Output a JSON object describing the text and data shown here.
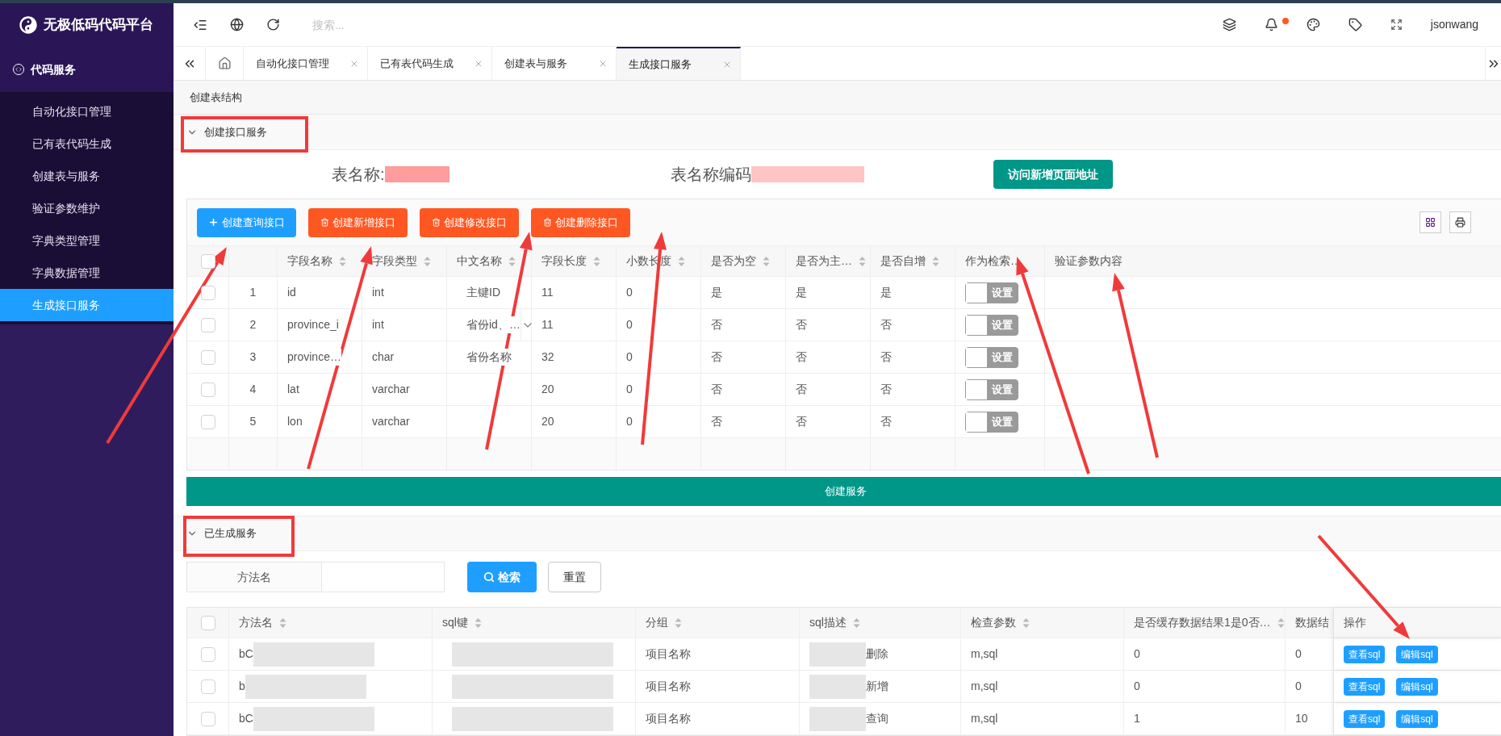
{
  "app": {
    "logo_text": "无极低码代码平台"
  },
  "header": {
    "search_placeholder": "搜索...",
    "notification_dot": true,
    "username": "jsonwang"
  },
  "sidebar": {
    "group": {
      "label": "代码服务",
      "expanded": true
    },
    "items": [
      {
        "label": "自动化接口管理",
        "selected": false
      },
      {
        "label": "已有表代码生成",
        "selected": false
      },
      {
        "label": "创建表与服务",
        "selected": false
      },
      {
        "label": "验证参数维护",
        "selected": false
      },
      {
        "label": "字典类型管理",
        "selected": false
      },
      {
        "label": "字典数据管理",
        "selected": false
      },
      {
        "label": "生成接口服务",
        "selected": true
      }
    ]
  },
  "tabs": [
    {
      "label": "自动化接口管理",
      "selected": false
    },
    {
      "label": "已有表代码生成",
      "selected": false
    },
    {
      "label": "创建表与服务",
      "selected": false
    },
    {
      "label": "生成接口服务",
      "selected": true
    }
  ],
  "breadcrumb": "创建表结构",
  "create_section": {
    "title": "创建接口服务",
    "expanded": true,
    "table_name": {
      "label": "表名称:",
      "redacted": true
    },
    "table_code": {
      "label": "表名称编码",
      "redacted": true
    },
    "visit_button": "访问新增页面地址",
    "all_checked": false,
    "buttons": [
      {
        "kind": "primary",
        "label": "创建查询接口"
      },
      {
        "kind": "danger",
        "label": "创建新增接口"
      },
      {
        "kind": "danger",
        "label": "创建修改接口"
      },
      {
        "kind": "danger",
        "label": "创建删除接口"
      }
    ],
    "columns": [
      {
        "label": "字段名称",
        "sortable": true
      },
      {
        "label": "字段类型",
        "sortable": true
      },
      {
        "label": "中文名称",
        "sortable": true
      },
      {
        "label": "字段长度",
        "sortable": true
      },
      {
        "label": "小数长度",
        "sortable": true
      },
      {
        "label": "是否为空",
        "sortable": true
      },
      {
        "label": "是否为主…",
        "sortable": true
      },
      {
        "label": "是否自增",
        "sortable": true
      },
      {
        "label": "作为检索…",
        "sortable": false
      },
      {
        "label": "验证参数内容",
        "sortable": false
      }
    ],
    "rows": [
      {
        "checked": false,
        "index": "1",
        "field": "id",
        "type": "int",
        "cn_name": {
          "text": "主键ID",
          "dropdown": false
        },
        "length": "11",
        "decimals": "0",
        "nullable": "是",
        "primary": "是",
        "auto_inc": "是",
        "search_switch": {
          "label": "设置",
          "on": false
        }
      },
      {
        "checked": false,
        "index": "2",
        "field": "province_i",
        "type": "int",
        "cn_name": {
          "text": "省份id、…",
          "dropdown": true
        },
        "length": "11",
        "decimals": "0",
        "nullable": "否",
        "primary": "否",
        "auto_inc": "否",
        "search_switch": {
          "label": "设置",
          "on": false
        }
      },
      {
        "checked": false,
        "index": "3",
        "field": "province…",
        "type": "char",
        "cn_name": {
          "text": "省份名称",
          "dropdown": false
        },
        "length": "32",
        "decimals": "0",
        "nullable": "否",
        "primary": "否",
        "auto_inc": "否",
        "search_switch": {
          "label": "设置",
          "on": false
        }
      },
      {
        "checked": false,
        "index": "4",
        "field": "lat",
        "type": "varchar",
        "length": "20",
        "decimals": "0",
        "nullable": "否",
        "primary": "否",
        "auto_inc": "否",
        "search_switch": {
          "label": "设置",
          "on": false
        }
      },
      {
        "checked": false,
        "index": "5",
        "field": "lon",
        "type": "varchar",
        "length": "20",
        "decimals": "0",
        "nullable": "否",
        "primary": "否",
        "auto_inc": "否",
        "search_switch": {
          "label": "设置",
          "on": false
        }
      }
    ],
    "submit_button": "创建服务"
  },
  "generated_section": {
    "title": "已生成服务",
    "expanded": true,
    "filter": {
      "label": "方法名"
    },
    "search_button": "检索",
    "reset_button": "重置",
    "all_checked": false,
    "columns": [
      {
        "label": "方法名",
        "sortable": true
      },
      {
        "label": "sql键",
        "sortable": true
      },
      {
        "label": "分组",
        "sortable": true
      },
      {
        "label": "sql描述",
        "sortable": true
      },
      {
        "label": "检查参数",
        "sortable": true
      },
      {
        "label": "是否缓存数据结果1是0否…",
        "sortable": true
      },
      {
        "label": "数据结",
        "sortable": false
      },
      {
        "label": "操作",
        "sortable": false
      }
    ],
    "rows": [
      {
        "checked": false,
        "redacted": true,
        "method_name": "bC",
        "group": "项目名称",
        "sql_desc": "删除",
        "check_params": "m,sql",
        "cache": "0",
        "data": "0",
        "actions": [
          "查看sql",
          "编辑sql"
        ]
      },
      {
        "checked": false,
        "redacted": true,
        "method_name": "b",
        "group": "项目名称",
        "sql_desc": "新增",
        "check_params": "m,sql",
        "cache": "0",
        "data": "0",
        "actions": [
          "查看sql",
          "编辑sql"
        ]
      },
      {
        "checked": false,
        "redacted": true,
        "method_name": "bC",
        "group": "项目名称",
        "sql_desc": "查询",
        "check_params": "m,sql",
        "cache": "1",
        "data": "10",
        "actions": [
          "查看sql",
          "编辑sql"
        ]
      }
    ]
  }
}
